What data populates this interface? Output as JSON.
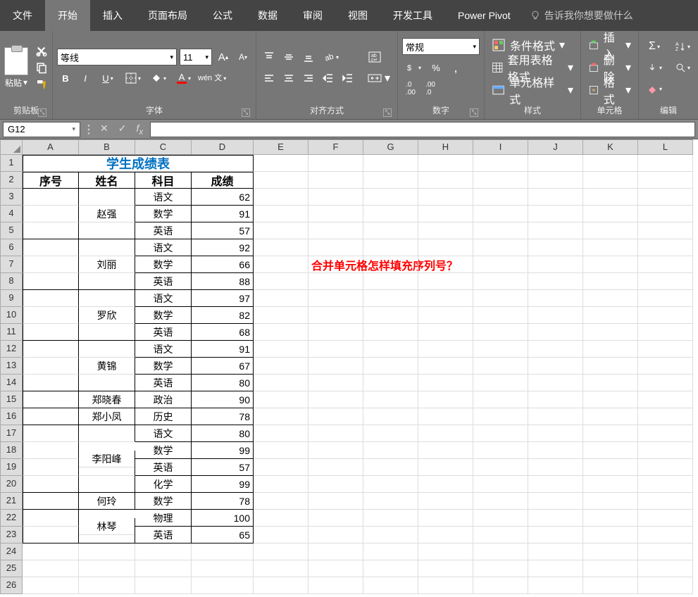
{
  "tabs": {
    "items": [
      "文件",
      "开始",
      "插入",
      "页面布局",
      "公式",
      "数据",
      "审阅",
      "视图",
      "开发工具",
      "Power Pivot"
    ],
    "active_index": 1,
    "tell_me": "告诉我你想要做什么"
  },
  "ribbon": {
    "clipboard": {
      "paste": "粘贴",
      "label": "剪贴板"
    },
    "font": {
      "name": "等线",
      "size": "11",
      "bold": "B",
      "italic": "I",
      "underline": "U",
      "phonetic": "wén 文",
      "label": "字体"
    },
    "align": {
      "wrap": "",
      "merge": "",
      "label": "对齐方式"
    },
    "number": {
      "format": "常规",
      "label": "数字"
    },
    "styles": {
      "cond": "条件格式",
      "table": "套用表格格式",
      "cell": "单元格样式",
      "label": "样式"
    },
    "cells": {
      "insert": "插入",
      "delete": "删除",
      "format": "格式",
      "label": "单元格"
    },
    "editing": {
      "label": "编辑"
    }
  },
  "namebox": "G12",
  "columns": [
    "A",
    "B",
    "C",
    "D",
    "E",
    "F",
    "G",
    "H",
    "I",
    "J",
    "K",
    "L"
  ],
  "title": "学生成绩表",
  "headers": [
    "序号",
    "姓名",
    "科目",
    "成绩"
  ],
  "data_rows": [
    {
      "n": 3,
      "name": "",
      "sub": "语文",
      "sc": 62,
      "bt": true
    },
    {
      "n": 4,
      "name": "赵强",
      "sub": "数学",
      "sc": 91
    },
    {
      "n": 5,
      "name": "",
      "sub": "英语",
      "sc": 57,
      "bb": true
    },
    {
      "n": 6,
      "name": "",
      "sub": "语文",
      "sc": 92
    },
    {
      "n": 7,
      "name": "刘丽",
      "sub": "数学",
      "sc": 66
    },
    {
      "n": 8,
      "name": "",
      "sub": "英语",
      "sc": 88,
      "bb": true
    },
    {
      "n": 9,
      "name": "",
      "sub": "语文",
      "sc": 97
    },
    {
      "n": 10,
      "name": "罗欣",
      "sub": "数学",
      "sc": 82
    },
    {
      "n": 11,
      "name": "",
      "sub": "英语",
      "sc": 68,
      "bb": true
    },
    {
      "n": 12,
      "name": "",
      "sub": "语文",
      "sc": 91
    },
    {
      "n": 13,
      "name": "黄锦",
      "sub": "数学",
      "sc": 67
    },
    {
      "n": 14,
      "name": "",
      "sub": "英语",
      "sc": 80,
      "bb": true
    },
    {
      "n": 15,
      "name": "郑晓春",
      "sub": "政治",
      "sc": 90,
      "bb": true
    },
    {
      "n": 16,
      "name": "郑小凤",
      "sub": "历史",
      "sc": 78,
      "bb": true
    },
    {
      "n": 17,
      "name": "",
      "sub": "语文",
      "sc": 80
    },
    {
      "n": 18,
      "name": "李阳峰",
      "sub": "数学",
      "sc": 99,
      "nameshift": true
    },
    {
      "n": 19,
      "name": "",
      "sub": "英语",
      "sc": 57
    },
    {
      "n": 20,
      "name": "",
      "sub": "化学",
      "sc": 99,
      "bb": true
    },
    {
      "n": 21,
      "name": "何玲",
      "sub": "数学",
      "sc": 78,
      "bb": true
    },
    {
      "n": 22,
      "name": "林琴",
      "sub": "物理",
      "sc": 100,
      "nameshift": true
    },
    {
      "n": 23,
      "name": "",
      "sub": "英语",
      "sc": 65,
      "bb": true
    }
  ],
  "annotation": "合并单元格怎样填充序列号？",
  "max_row": 26
}
